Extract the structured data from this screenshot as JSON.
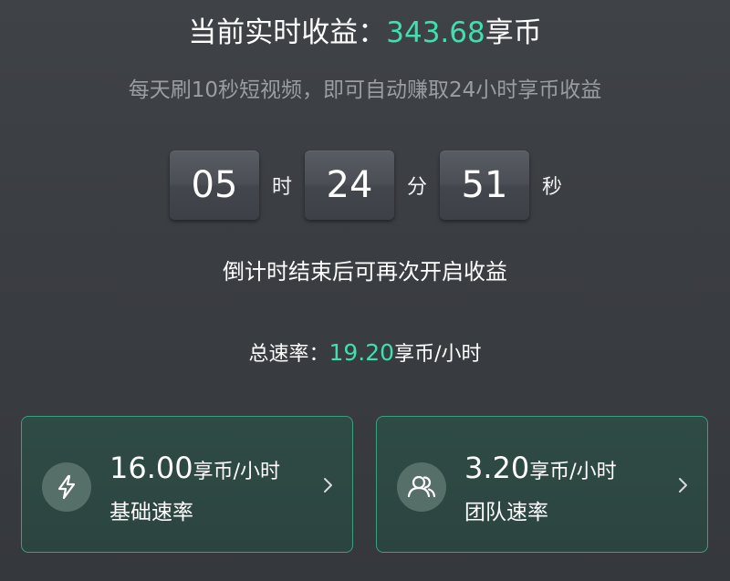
{
  "header": {
    "earnings_prefix": "当前实时收益：",
    "earnings_value": "343.68",
    "earnings_unit": "享币",
    "subtitle": "每天刷10秒短视频，即可自动赚取24小时享币收益"
  },
  "countdown": {
    "hours": "05",
    "hours_unit": "时",
    "minutes": "24",
    "minutes_unit": "分",
    "seconds": "51",
    "seconds_unit": "秒",
    "hint": "倒计时结束后可再次开启收益"
  },
  "total_rate": {
    "label": "总速率：",
    "value": "19.20",
    "unit": "享币/小时"
  },
  "cards": {
    "base": {
      "value": "16.00",
      "unit": "享币/小时",
      "label": "基础速率",
      "icon": "lightning-icon"
    },
    "team": {
      "value": "3.20",
      "unit": "享币/小时",
      "label": "团队速率",
      "icon": "team-icon"
    }
  },
  "colors": {
    "accent": "#3ee0b0",
    "card_border": "#3d9e82",
    "card_bg": "#2f4b45",
    "background": "#3a3d42"
  }
}
